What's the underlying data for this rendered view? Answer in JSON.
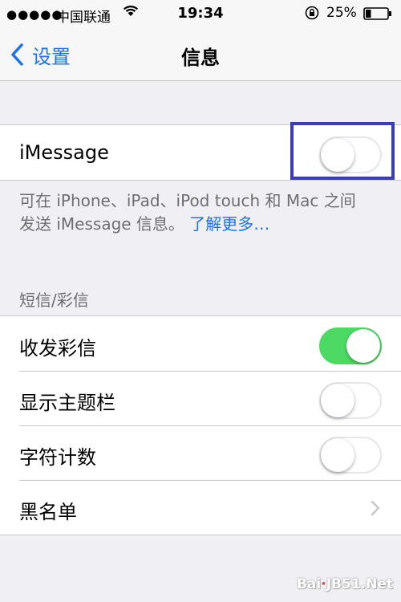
{
  "status_bar": {
    "signal": "●●●●●",
    "carrier": "中国联通",
    "time": "19:34",
    "battery_percent": "25%",
    "battery_level": 0.25
  },
  "nav": {
    "back_label": "设置",
    "title": "信息"
  },
  "imessage": {
    "label": "iMessage",
    "enabled": false,
    "description_line1": "可在 iPhone、iPad、iPod touch 和 Mac 之间",
    "description_line2": "发送 iMessage 信息。",
    "learn_more": "了解更多…"
  },
  "sms_section": {
    "header": "短信/彩信",
    "rows": [
      {
        "label": "收发彩信",
        "enabled": true
      },
      {
        "label": "显示主题栏",
        "enabled": false
      },
      {
        "label": "字符计数",
        "enabled": false
      },
      {
        "label": "黑名单",
        "type": "disclosure"
      }
    ]
  },
  "watermark": {
    "text_main": "Bai",
    "text_site": "JB51.Net",
    "text_dot": "·"
  },
  "colors": {
    "accent": "#1a73e8",
    "toggle_on": "#4cd964",
    "highlight": "#3c3cb4"
  }
}
